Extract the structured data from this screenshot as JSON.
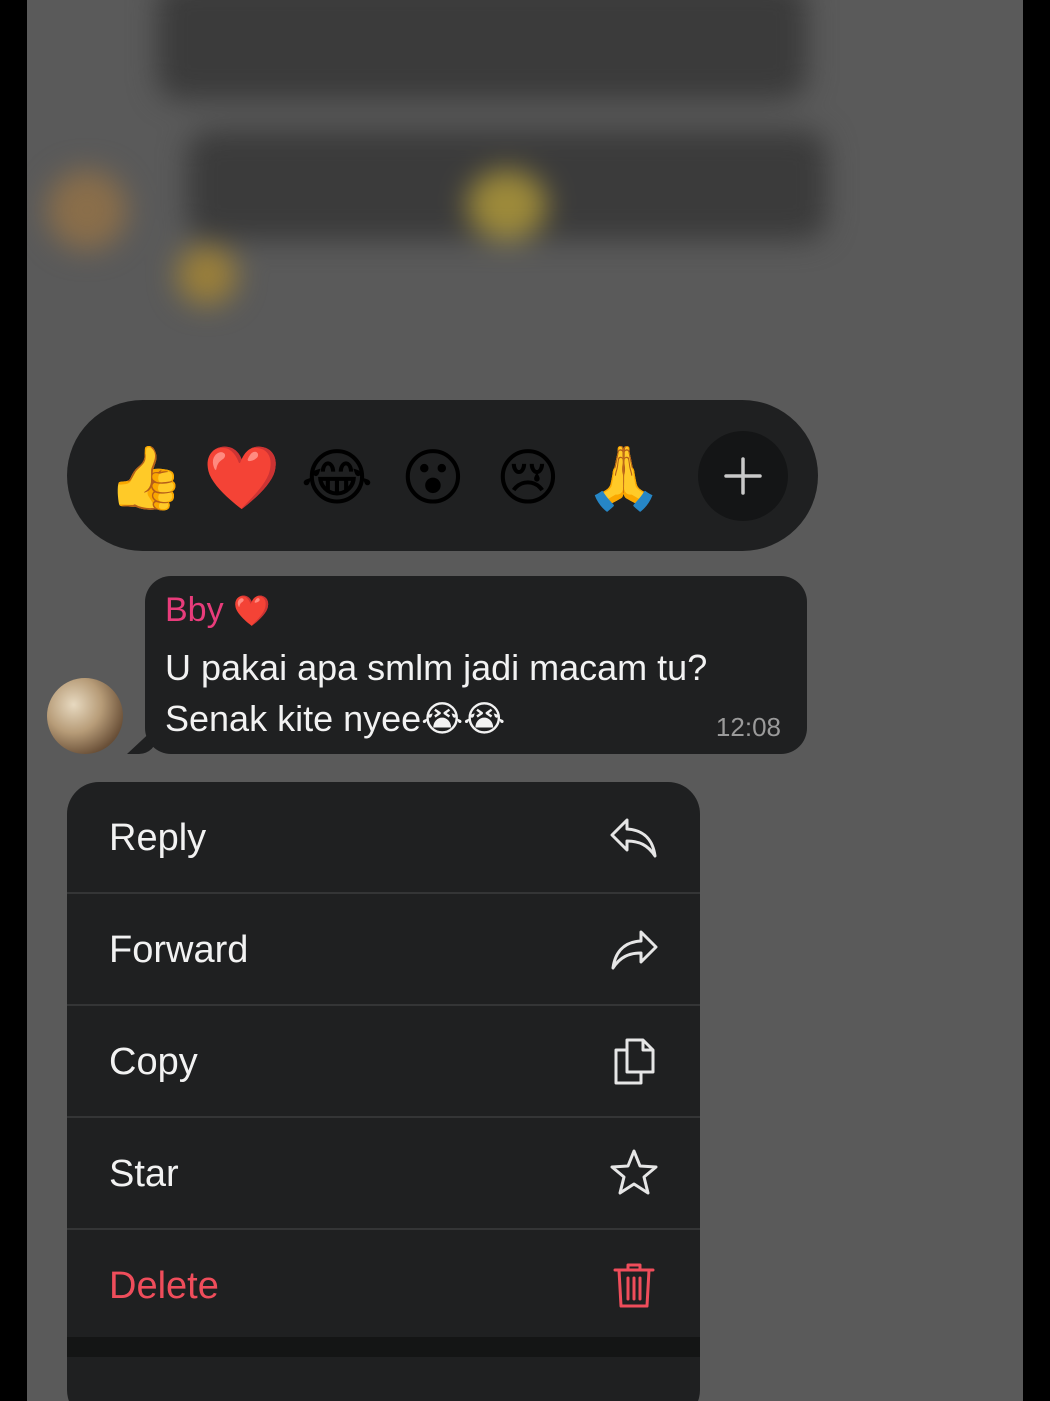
{
  "reactions": [
    {
      "emoji": "👍",
      "name": "thumbs-up"
    },
    {
      "emoji": "❤️",
      "name": "heart"
    },
    {
      "emoji": "😂",
      "name": "face-with-tears-of-joy"
    },
    {
      "emoji": "😮",
      "name": "face-with-open-mouth"
    },
    {
      "emoji": "😢",
      "name": "crying-face"
    },
    {
      "emoji": "🙏",
      "name": "folded-hands"
    }
  ],
  "reaction_more_icon": "plus-icon",
  "message": {
    "sender": "Bby",
    "sender_heart": "❤️",
    "line1": "U pakai apa smlm jadi macam tu?",
    "line2": "Senak kite nyee😭😭",
    "time": "12:08"
  },
  "menu": {
    "items": [
      {
        "label": "Reply",
        "icon": "reply-icon"
      },
      {
        "label": "Forward",
        "icon": "forward-icon"
      },
      {
        "label": "Copy",
        "icon": "copy-icon"
      },
      {
        "label": "Star",
        "icon": "star-icon"
      },
      {
        "label": "Delete",
        "icon": "trash-icon"
      }
    ]
  },
  "colors": {
    "sender": "#e83c7b",
    "delete": "#ef4d5b",
    "panel": "#1f2021"
  }
}
